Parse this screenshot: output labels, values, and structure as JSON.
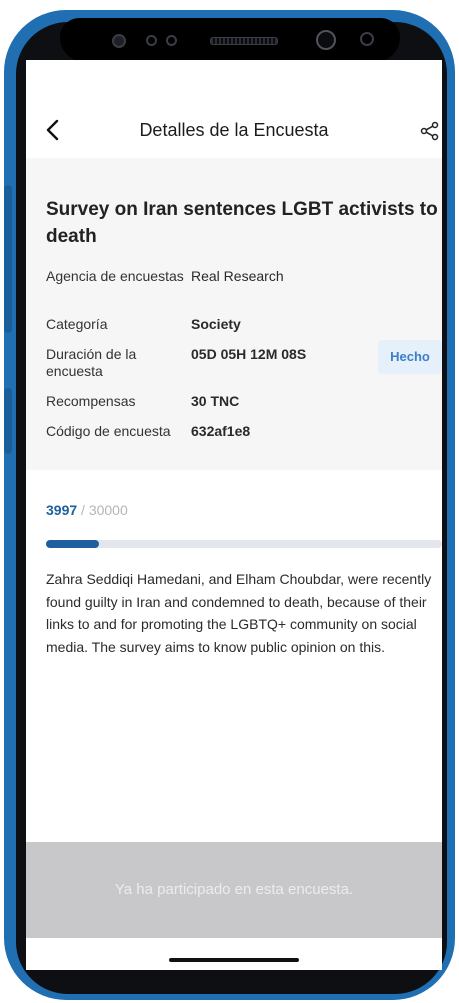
{
  "header": {
    "title": "Detalles de la Encuesta",
    "back_icon": "chevron-left-icon",
    "share_icon": "share-icon"
  },
  "survey": {
    "title": "Survey on Iran sentences LGBT activists to death",
    "details": [
      {
        "label": "Agencia de encuestas",
        "value": "Real Research"
      },
      {
        "label": "Categoría",
        "value": "Society"
      },
      {
        "label": "Duración de la encuesta",
        "value": "05D 05H 12M 08S"
      },
      {
        "label": "Recompensas",
        "value": "30 TNC"
      },
      {
        "label": "Código de encuesta",
        "value": "632af1e8"
      }
    ],
    "status_badge": "Hecho"
  },
  "progress": {
    "current": "3997",
    "separator": " / ",
    "total": "30000",
    "fraction": 0.133
  },
  "description": "Zahra Seddiqi Hamedani, and Elham Choubdar, were recently found guilty in Iran and condemned to death, because of their links to and for promoting the LGBTQ+ community on social media. The survey aims to know public opinion on this.",
  "footer": {
    "participated_text": "Ya ha participado en esta encuesta."
  },
  "colors": {
    "frame": "#1f6fb2",
    "accent": "#1e5fa0",
    "badge_bg": "#e6f0fb",
    "footer_bg": "#c8c8ca"
  }
}
